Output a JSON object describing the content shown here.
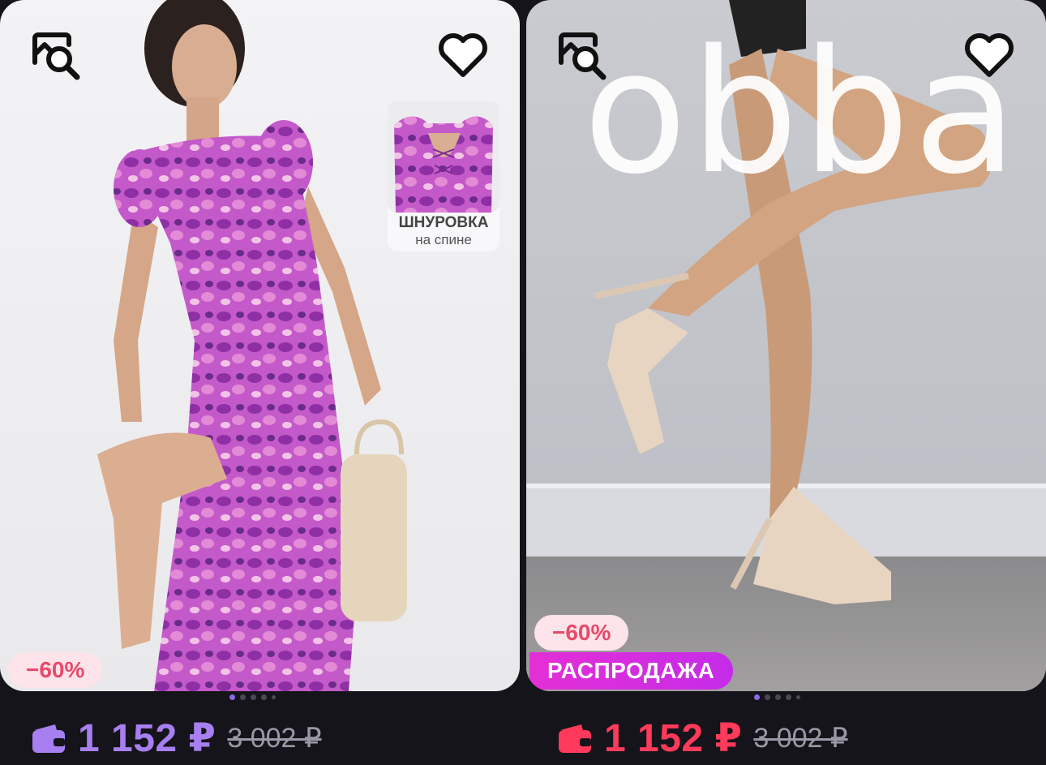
{
  "colors": {
    "background": "#15141a",
    "price_purple": "#a77ff0",
    "price_red": "#ff3a5a",
    "discount_text": "#e84a6a",
    "discount_bg": "#fde4ea",
    "sale_gradient_start": "#e42fd6",
    "sale_gradient_end": "#c52ce8"
  },
  "products": [
    {
      "promo_line1": "ШНУРОВКА",
      "promo_line2": "на спине",
      "discount": "−60%",
      "price": "1 152 ₽",
      "old_price": "3 002 ₽",
      "wallet_icon": "wallet-icon",
      "favorite_icon": "heart-outline-icon",
      "search_icon": "image-search-icon",
      "carousel": {
        "total": 5,
        "active": 1
      }
    },
    {
      "brand_logo": "obba",
      "discount": "−60%",
      "sale_label": "РАСПРОДАЖА",
      "price": "1 152 ₽",
      "old_price": "3 002 ₽",
      "wallet_icon": "wallet-icon",
      "favorite_icon": "heart-outline-icon",
      "search_icon": "image-search-icon",
      "carousel": {
        "total": 5,
        "active": 1
      }
    }
  ]
}
